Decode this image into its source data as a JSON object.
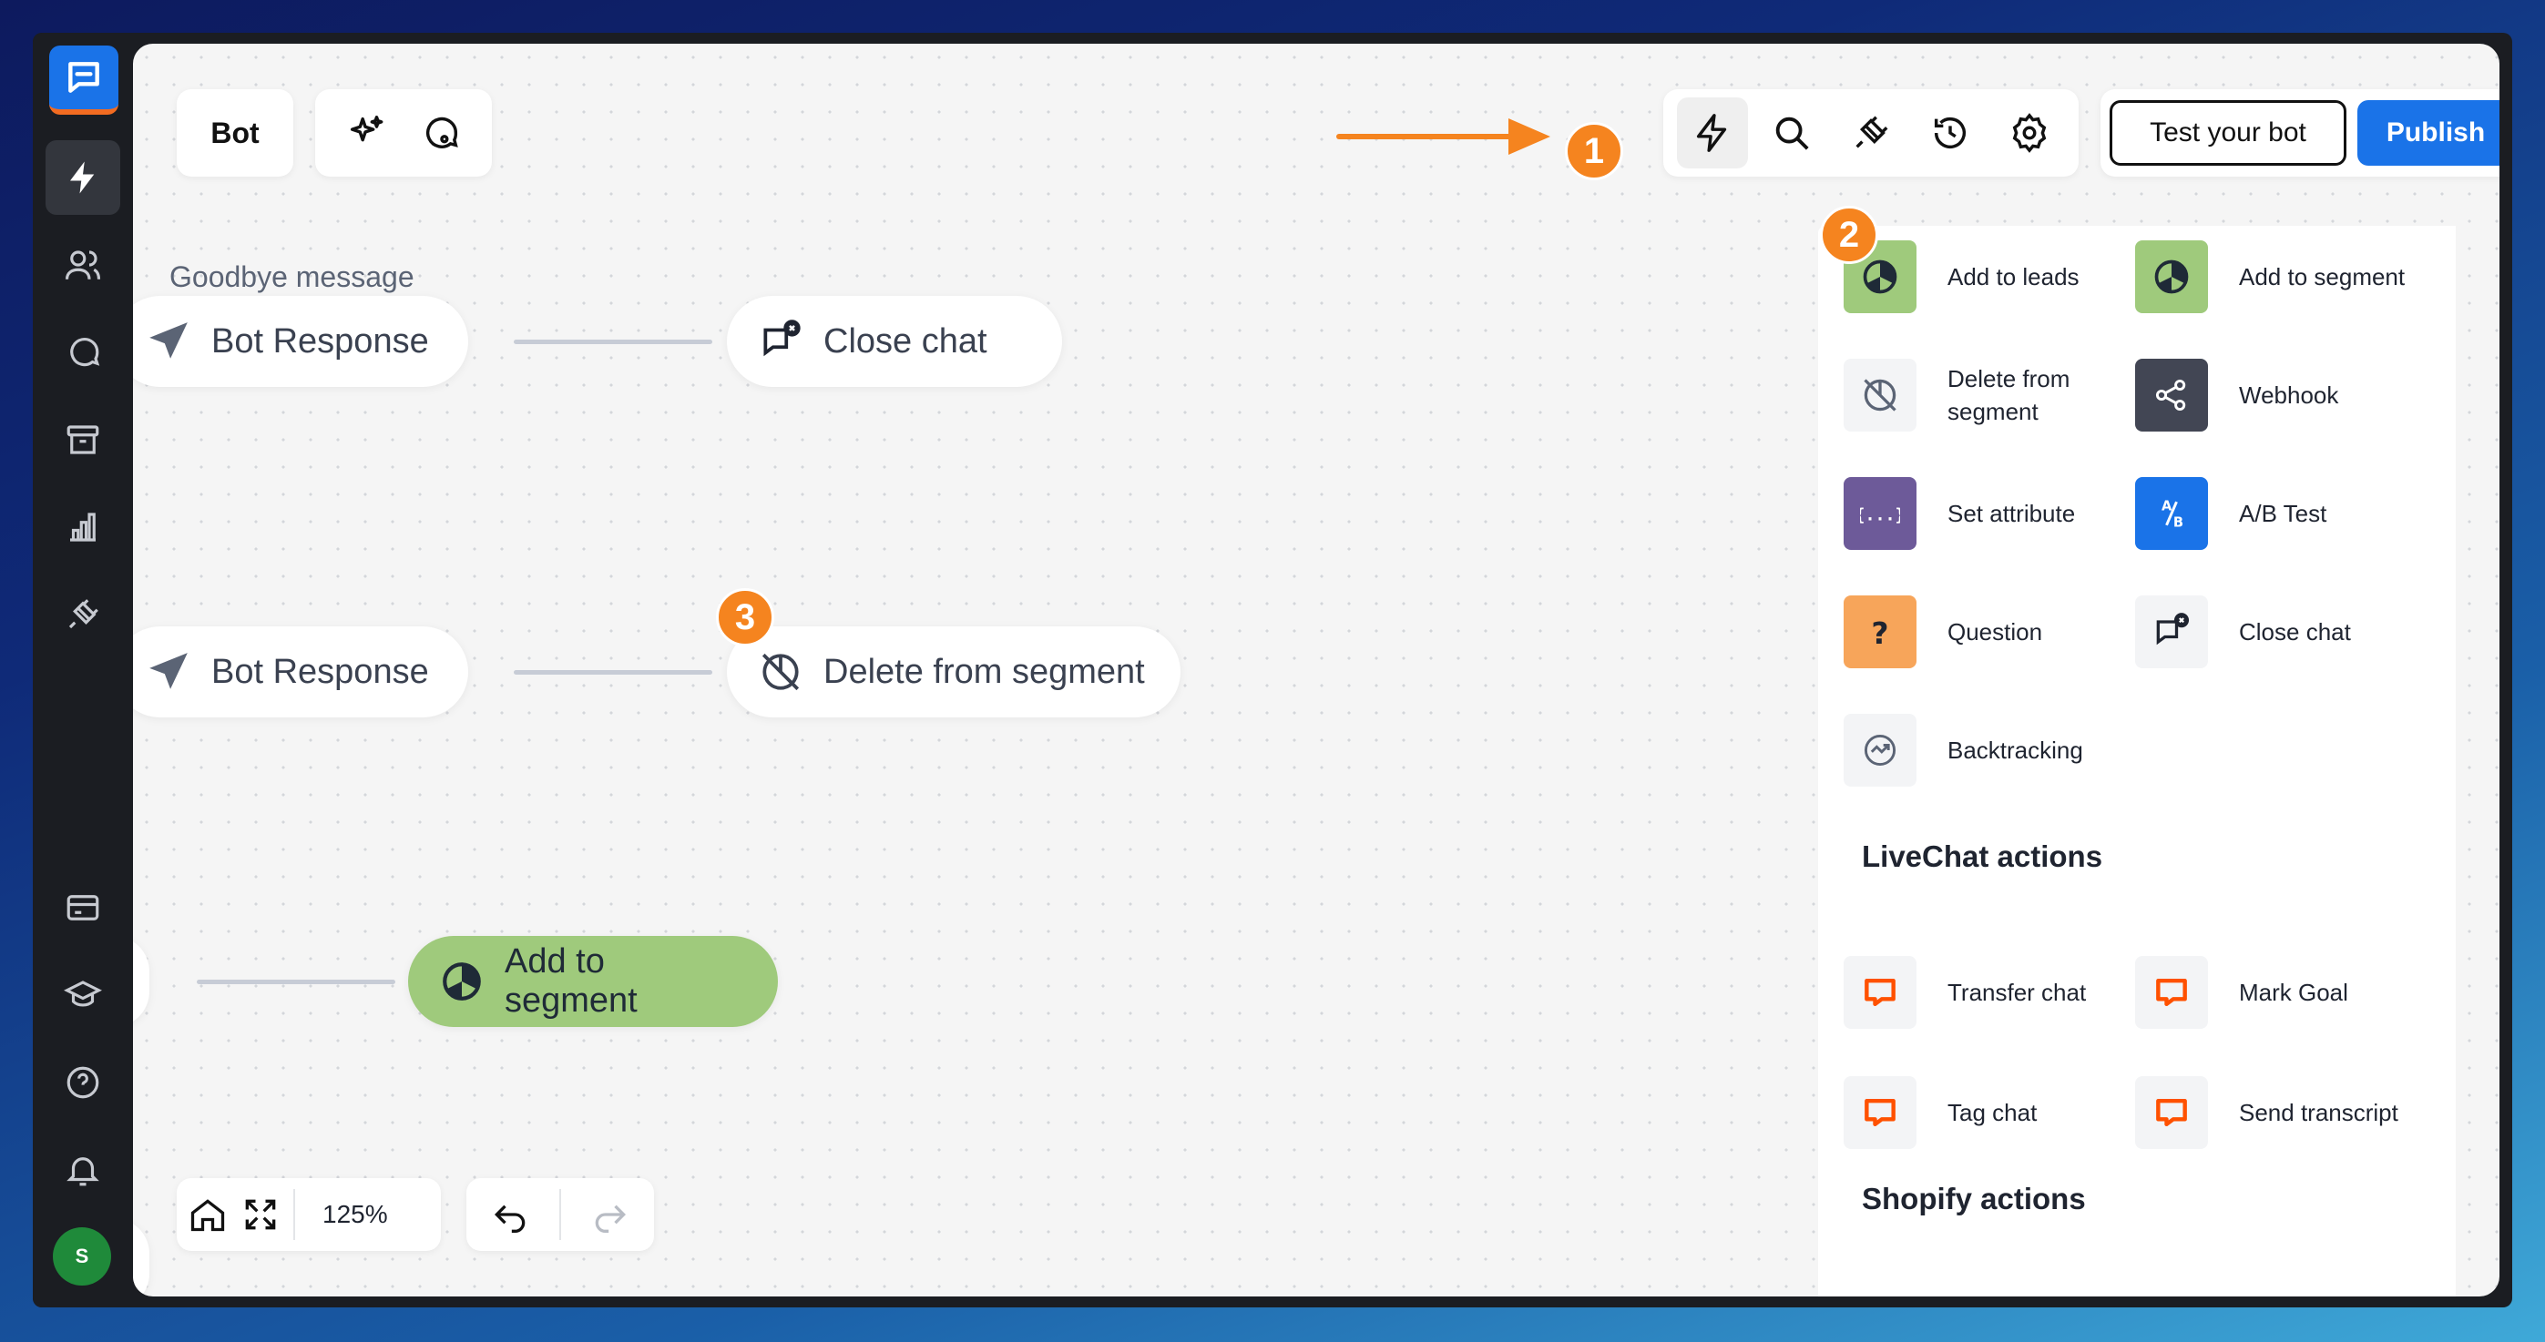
{
  "toolbar": {
    "bot_label": "Bot",
    "test_button": "Test your bot",
    "publish_button": "Publish"
  },
  "canvas": {
    "section_title": "Goodbye message",
    "nodes": [
      {
        "label": "Bot Response"
      },
      {
        "label": "Close chat"
      },
      {
        "label": "Bot Response"
      },
      {
        "label": "Delete from segment"
      },
      {
        "label": "Add to segment"
      }
    ]
  },
  "badges": [
    "1",
    "2",
    "3"
  ],
  "panel": {
    "items": [
      {
        "label": "Add to leads",
        "icon": "leads-pie-icon",
        "color": "#9fca7c"
      },
      {
        "label": "Add to segment",
        "icon": "segment-pie-icon",
        "color": "#9fca7c"
      },
      {
        "label": "Delete from segment",
        "icon": "delete-segment-icon",
        "color": "#f3f4f6"
      },
      {
        "label": "Webhook",
        "icon": "webhook-icon",
        "color": "#424654"
      },
      {
        "label": "Set attribute",
        "icon": "braces-icon",
        "color": "#6d5a99"
      },
      {
        "label": "A/B Test",
        "icon": "ab-test-icon",
        "color": "#1a73e8"
      },
      {
        "label": "Question",
        "icon": "question-icon",
        "color": "#f7a55a"
      },
      {
        "label": "Close chat",
        "icon": "close-chat-icon",
        "color": "#f3f4f6"
      },
      {
        "label": "Backtracking",
        "icon": "backtracking-icon",
        "color": "#f3f4f6"
      }
    ],
    "livechat_title": "LiveChat actions",
    "livechat_items": [
      {
        "label": "Transfer chat"
      },
      {
        "label": "Mark Goal"
      },
      {
        "label": "Tag chat"
      },
      {
        "label": "Send transcript"
      }
    ],
    "shopify_title": "Shopify actions"
  },
  "bottom": {
    "zoom": "125%"
  },
  "sidebar": {
    "avatar": "S"
  },
  "colors": {
    "accent": "#1a73e8",
    "badge": "#f5841f",
    "livechat": "#ff5100",
    "node_green": "#9fca7c"
  }
}
